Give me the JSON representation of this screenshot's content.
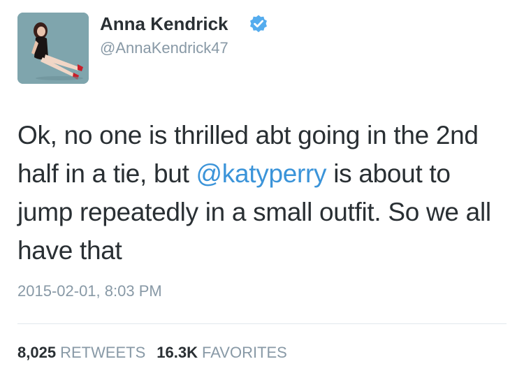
{
  "user": {
    "display_name": "Anna Kendrick",
    "handle": "@AnnaKendrick47",
    "verified": true
  },
  "tweet": {
    "text_before": "Ok, no one is thrilled abt going in the 2nd half in a tie, but ",
    "mention": "@katyperry",
    "text_after": " is about to jump repeatedly in a small outfit. So we all have that",
    "timestamp": "2015-02-01, 8:03 PM"
  },
  "stats": {
    "retweets_count": "8,025",
    "retweets_label": "RETWEETS",
    "favorites_count": "16.3K",
    "favorites_label": "FAVORITES"
  },
  "colors": {
    "text": "#292f33",
    "secondary": "#8899a6",
    "link": "#3b94d9",
    "verified": "#55acee",
    "divider": "#e1e8ed"
  },
  "icons": {
    "verified": "verified-badge-icon"
  }
}
